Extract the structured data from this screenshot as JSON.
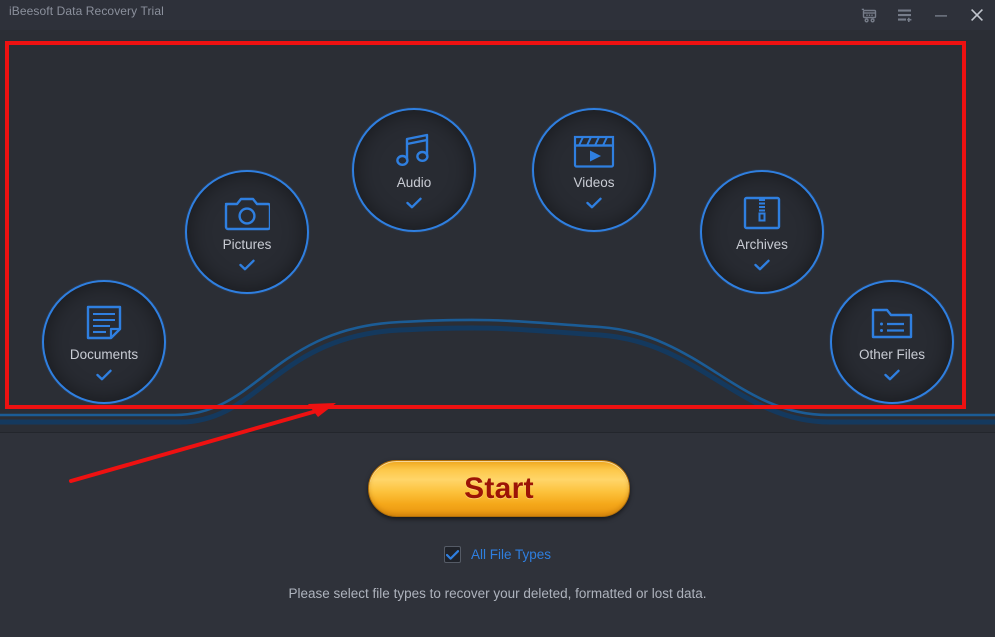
{
  "window": {
    "title": "iBeesoft Data Recovery Trial",
    "controls": [
      {
        "name": "cart-icon",
        "label": "Buy"
      },
      {
        "name": "menu-icon",
        "label": "Menu"
      },
      {
        "name": "minimize-icon",
        "label": "Minimize"
      },
      {
        "name": "close-icon",
        "label": "Close"
      }
    ]
  },
  "theme": {
    "background": "#2b2e35",
    "titlebar": "#2e313a",
    "panel": "#2f323a",
    "accent_blue": "#2f7fe0",
    "label_text": "#c9ccd4",
    "hint_text": "#aeb3bd",
    "annotation_red": "#ee1111",
    "start_gold": "#ffd569",
    "start_text": "#9c1406"
  },
  "file_types": [
    {
      "id": "pictures",
      "label": "Pictures",
      "icon": "camera-icon",
      "checked": true
    },
    {
      "id": "audio",
      "label": "Audio",
      "icon": "music-note-icon",
      "checked": true
    },
    {
      "id": "videos",
      "label": "Videos",
      "icon": "clapperboard-icon",
      "checked": true
    },
    {
      "id": "archives",
      "label": "Archives",
      "icon": "zip-archive-icon",
      "checked": true
    },
    {
      "id": "documents",
      "label": "Documents",
      "icon": "document-page-icon",
      "checked": true
    },
    {
      "id": "other_files",
      "label": "Other Files",
      "icon": "folder-list-icon",
      "checked": true
    }
  ],
  "actions": {
    "start_label": "Start"
  },
  "options": {
    "all_file_types_label": "All File Types",
    "all_file_types_checked": true
  },
  "footer": {
    "hint": "Please select file types to recover your deleted, formatted or lost data."
  }
}
